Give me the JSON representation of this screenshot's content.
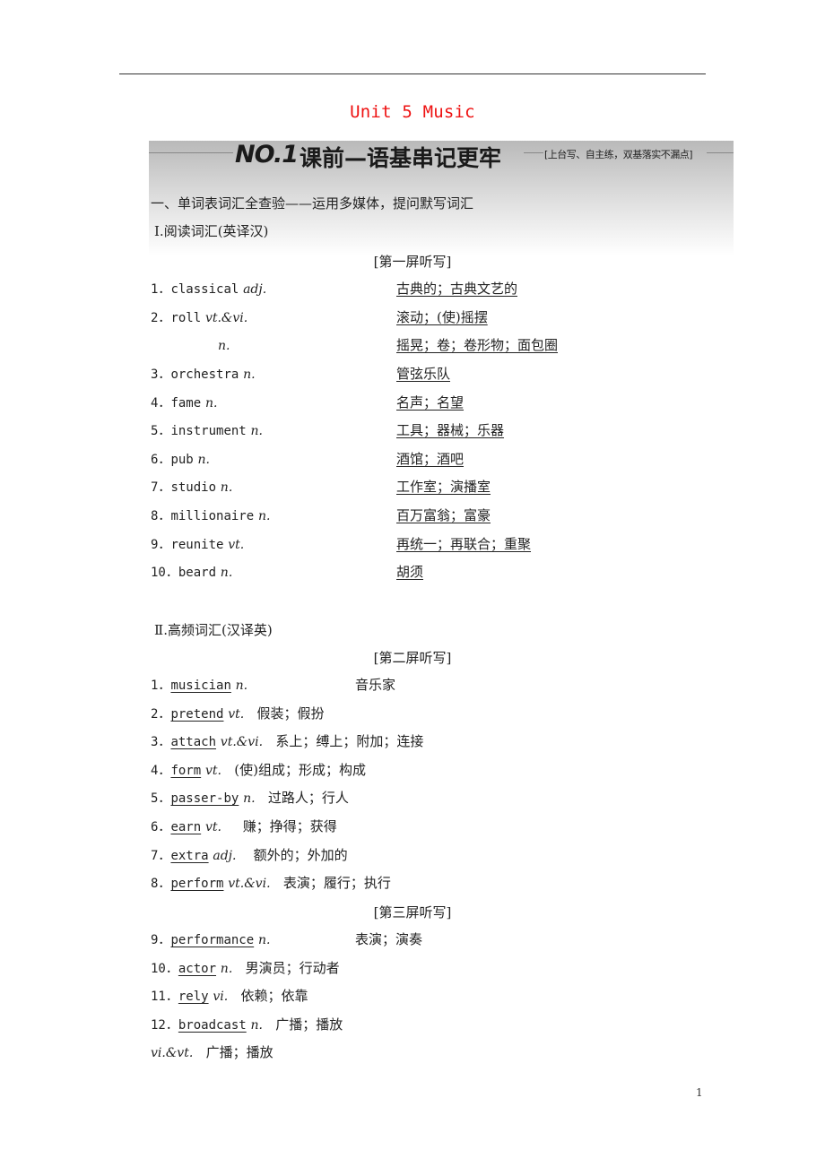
{
  "document": {
    "unit_title": "Unit 5  Music",
    "banner": {
      "number": "NO.1",
      "title": "课前—语基串记更牢",
      "subtitle": "[上台写、自主练，双基落实不漏点]"
    },
    "section_heading": "一、单词表词汇全查验——运用多媒体，提问默写词汇",
    "part1": {
      "heading": "Ⅰ.阅读词汇(英译汉)",
      "screen_label": "[第一屏听写]",
      "items": [
        {
          "num": "1．",
          "word": "classical",
          "pos": "adj.",
          "meaning": "古典的；古典文艺的"
        },
        {
          "num": "2．",
          "word": "roll",
          "pos": "vt.&vi.",
          "meaning": "滚动；(使)摇摆"
        },
        {
          "num": "",
          "word": "",
          "pos": "n.",
          "meaning": "摇晃；卷；卷形物；面包圈"
        },
        {
          "num": "3．",
          "word": "orchestra",
          "pos": "n.",
          "meaning": "管弦乐队"
        },
        {
          "num": "4．",
          "word": "fame",
          "pos": "n.",
          "meaning": "名声；名望"
        },
        {
          "num": "5．",
          "word": "instrument",
          "pos": "n.",
          "meaning": "工具；器械；乐器"
        },
        {
          "num": "6．",
          "word": "pub",
          "pos": "n.",
          "meaning": "酒馆；酒吧"
        },
        {
          "num": "7．",
          "word": "studio",
          "pos": "n.",
          "meaning": "工作室；演播室"
        },
        {
          "num": "8．",
          "word": "millionaire",
          "pos": "n.",
          "meaning": "百万富翁；富豪"
        },
        {
          "num": "9．",
          "word": "reunite",
          "pos": "vt.",
          "meaning": "再统一；再联合；重聚"
        },
        {
          "num": "10．",
          "word": "beard",
          "pos": "n.",
          "meaning": "胡须"
        }
      ]
    },
    "part2": {
      "heading": "Ⅱ.高频词汇(汉译英)",
      "screen_label_2": "[第二屏听写]",
      "screen_label_3": "[第三屏听写]",
      "items": [
        {
          "num": "1．",
          "word": "musician",
          "pos": "n.",
          "meaning": "音乐家"
        },
        {
          "num": "2．",
          "word": "pretend",
          "pos": "vt.",
          "meaning": "假装；假扮"
        },
        {
          "num": "3．",
          "word": "attach",
          "pos": "vt.&vi.",
          "meaning": "系上；缚上；附加；连接"
        },
        {
          "num": "4．",
          "word": "form",
          "pos": "vt.",
          "meaning": "(使)组成；形成；构成"
        },
        {
          "num": "5．",
          "word": "passer-by",
          "pos": "n.",
          "meaning": "过路人；行人"
        },
        {
          "num": "6．",
          "word": "earn",
          "pos": "vt.",
          "meaning": "赚；挣得；获得"
        },
        {
          "num": "7．",
          "word": "extra",
          "pos": "adj.",
          "meaning": "额外的；外加的"
        },
        {
          "num": "8．",
          "word": "perform",
          "pos": "vt.&vi.",
          "meaning": "表演；履行；执行"
        },
        {
          "num": "9．",
          "word": "performance",
          "pos": "n.",
          "meaning": "表演；演奏"
        },
        {
          "num": "10．",
          "word": "actor",
          "pos": "n.",
          "meaning": "男演员；行动者"
        },
        {
          "num": "11．",
          "word": "rely",
          "pos": "vi.",
          "meaning": "依赖；依靠"
        },
        {
          "num": "12．",
          "word": "broadcast",
          "pos": "n.",
          "meaning": "广播；播放"
        }
      ],
      "extra_line": {
        "pos": "vi.&vt.",
        "meaning": "广播；播放"
      }
    },
    "page_number": "1"
  }
}
